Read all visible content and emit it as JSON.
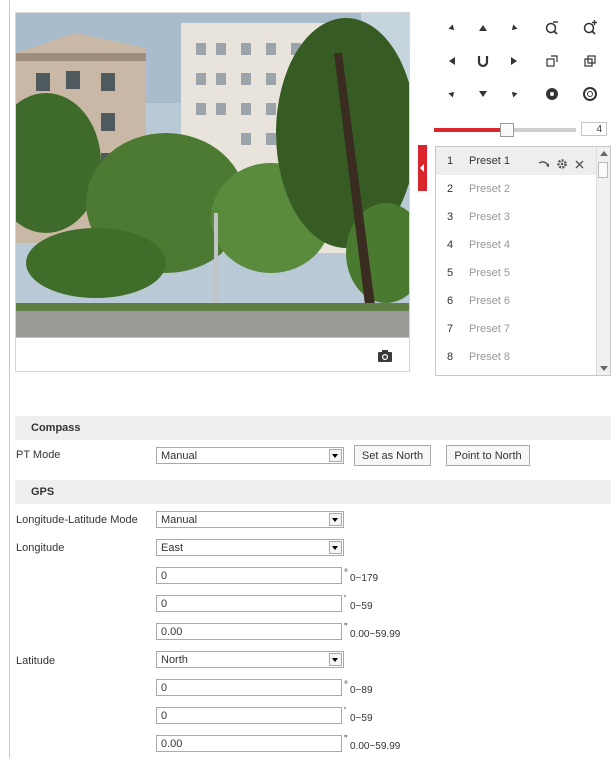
{
  "ptz": {
    "speed_value": "4",
    "speed_level_percent": 55
  },
  "presets": {
    "items": [
      {
        "number": "1",
        "name": "Preset 1"
      },
      {
        "number": "2",
        "name": "Preset 2"
      },
      {
        "number": "3",
        "name": "Preset 3"
      },
      {
        "number": "4",
        "name": "Preset 4"
      },
      {
        "number": "5",
        "name": "Preset 5"
      },
      {
        "number": "6",
        "name": "Preset 6"
      },
      {
        "number": "7",
        "name": "Preset 7"
      },
      {
        "number": "8",
        "name": "Preset 8"
      }
    ]
  },
  "compass": {
    "title": "Compass",
    "pt_mode_label": "PT Mode",
    "pt_mode_value": "Manual",
    "set_north_label": "Set as North",
    "point_north_label": "Point to North"
  },
  "gps": {
    "title": "GPS",
    "mode_label": "Longitude-Latitude Mode",
    "mode_value": "Manual",
    "longitude_label": "Longitude",
    "longitude_dir": "East",
    "lon_deg": "0",
    "lon_deg_range": "0~179",
    "lon_min": "0",
    "lon_min_range": "0~59",
    "lon_sec": "0.00",
    "lon_sec_range": "0.00~59.99",
    "latitude_label": "Latitude",
    "latitude_dir": "North",
    "lat_deg": "0",
    "lat_deg_range": "0~89",
    "lat_min": "0",
    "lat_min_range": "0~59",
    "lat_sec": "0.00",
    "lat_sec_range": "0.00~59.99",
    "degree_symbol": "°",
    "minute_symbol": "'",
    "second_symbol": "\""
  },
  "colors": {
    "accent": "#d9252b"
  }
}
